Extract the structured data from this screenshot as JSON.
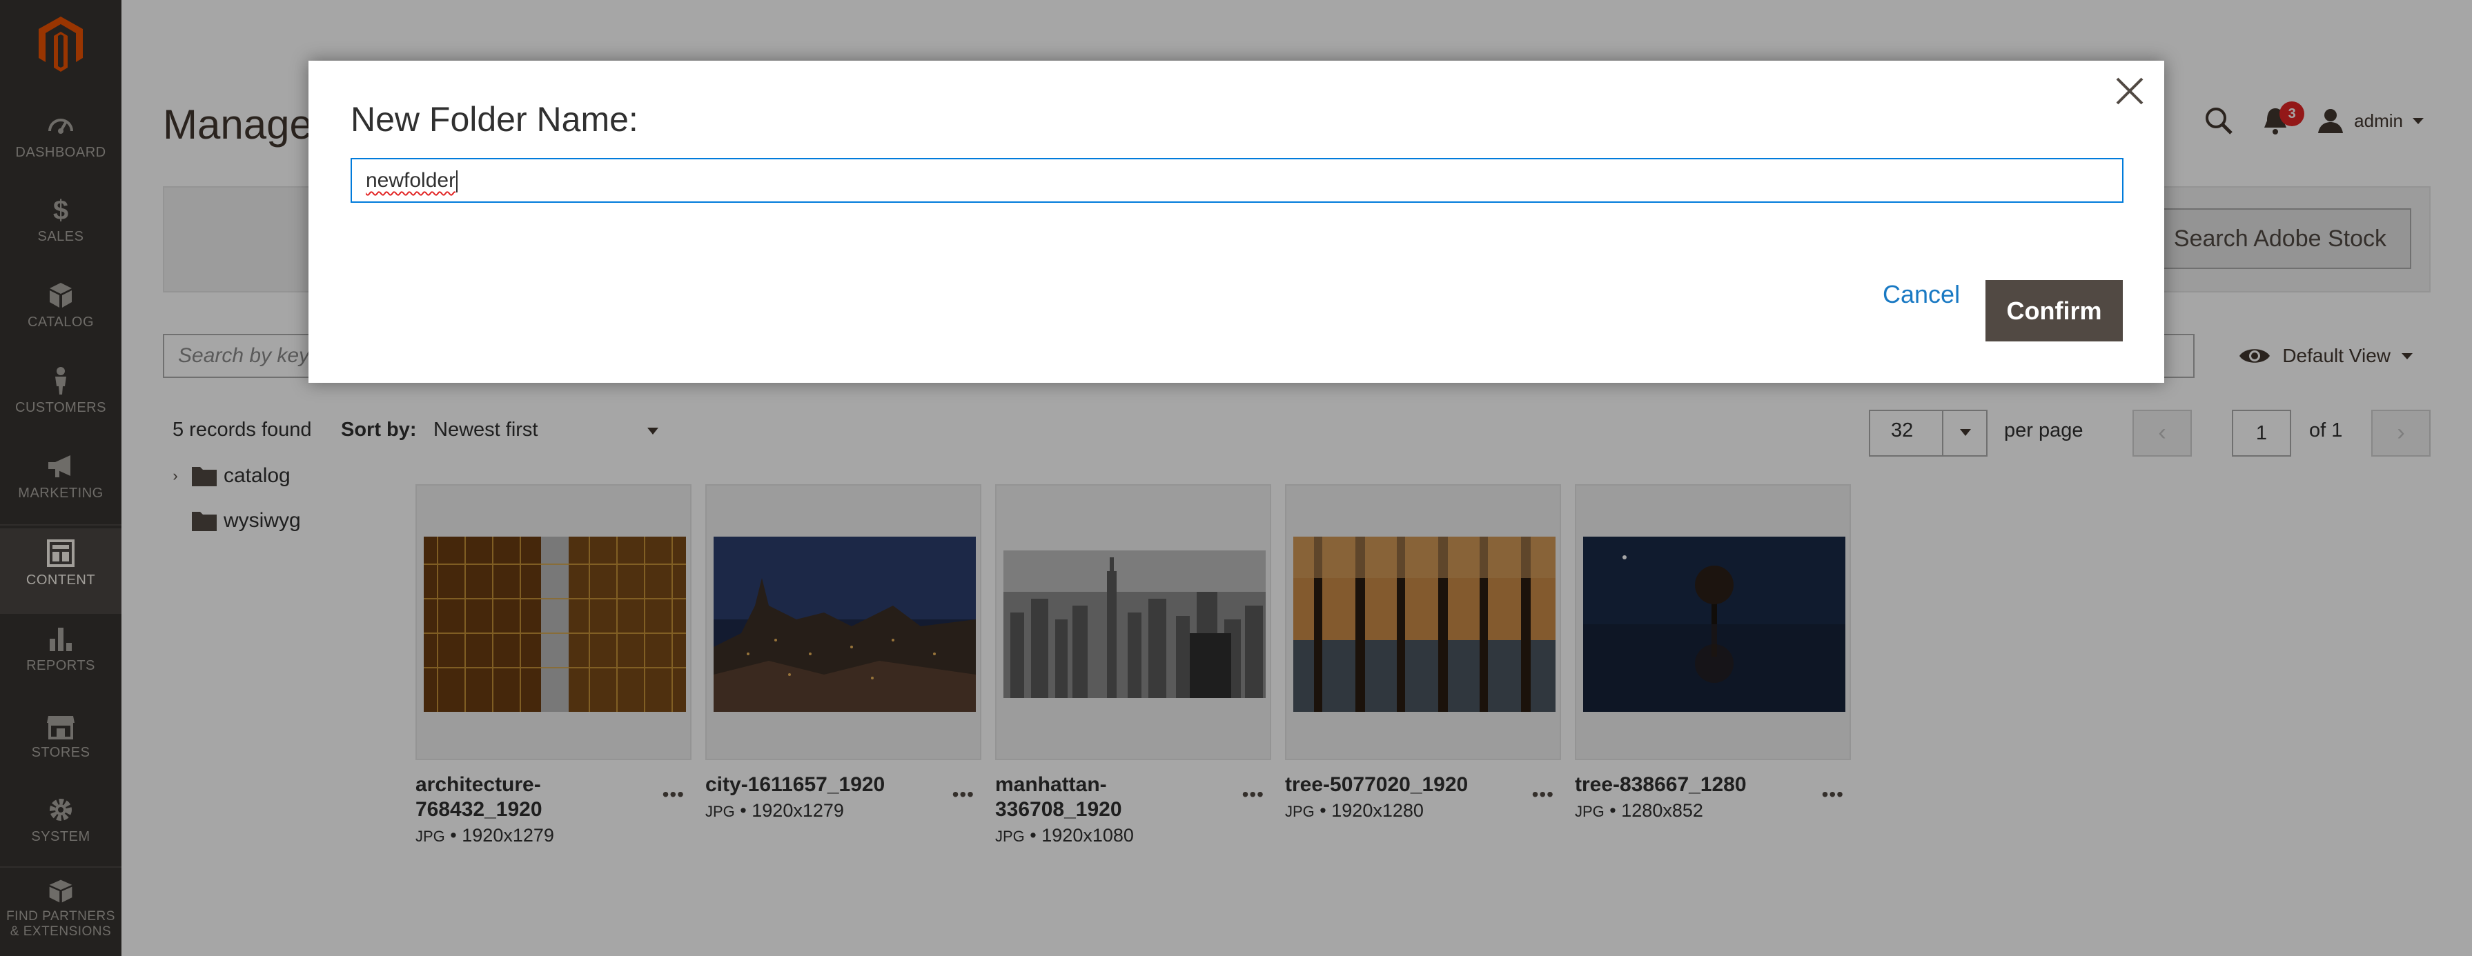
{
  "sidebar": {
    "items": [
      {
        "label": "DASHBOARD",
        "icon": "dashboard-icon"
      },
      {
        "label": "SALES",
        "icon": "dollar-icon"
      },
      {
        "label": "CATALOG",
        "icon": "cube-icon"
      },
      {
        "label": "CUSTOMERS",
        "icon": "person-icon"
      },
      {
        "label": "MARKETING",
        "icon": "megaphone-icon"
      },
      {
        "label": "CONTENT",
        "icon": "layout-icon"
      },
      {
        "label": "REPORTS",
        "icon": "bar-chart-icon"
      },
      {
        "label": "STORES",
        "icon": "storefront-icon"
      },
      {
        "label": "SYSTEM",
        "icon": "gear-icon"
      },
      {
        "label": "FIND PARTNERS & EXTENSIONS",
        "icon": "box-icon"
      }
    ],
    "active": "CONTENT"
  },
  "page": {
    "title": "Manage",
    "notifications_count": "3",
    "user": "admin",
    "search_adobe_stock": "Search Adobe Stock",
    "search_placeholder": "Search by keyw",
    "default_view": "Default View"
  },
  "toolbar": {
    "records": "5 records found",
    "sort_label": "Sort by:",
    "sort_value": "Newest first",
    "per_page_value": "32",
    "per_page_label": "per page",
    "page_current": "1",
    "page_of": "of 1"
  },
  "folders": [
    {
      "name": "catalog",
      "expandable": true
    },
    {
      "name": "wysiwyg",
      "expandable": false
    }
  ],
  "images": [
    {
      "name": "architecture-768432_1920",
      "ext": "JPG",
      "dims": "1920x1279"
    },
    {
      "name": "city-1611657_1920",
      "ext": "JPG",
      "dims": "1920x1279"
    },
    {
      "name": "manhattan-336708_1920",
      "ext": "JPG",
      "dims": "1920x1080"
    },
    {
      "name": "tree-5077020_1920",
      "ext": "JPG",
      "dims": "1920x1280"
    },
    {
      "name": "tree-838667_1280",
      "ext": "JPG",
      "dims": "1280x852"
    }
  ],
  "modal": {
    "title": "New Folder Name:",
    "input_value": "newfolder",
    "cancel_label": "Cancel",
    "confirm_label": "Confirm"
  },
  "colors": {
    "sidebar_bg": "#373330",
    "primary_button": "#514943",
    "link": "#1979c3",
    "input_focus": "#007bdb",
    "badge": "#e22626"
  }
}
